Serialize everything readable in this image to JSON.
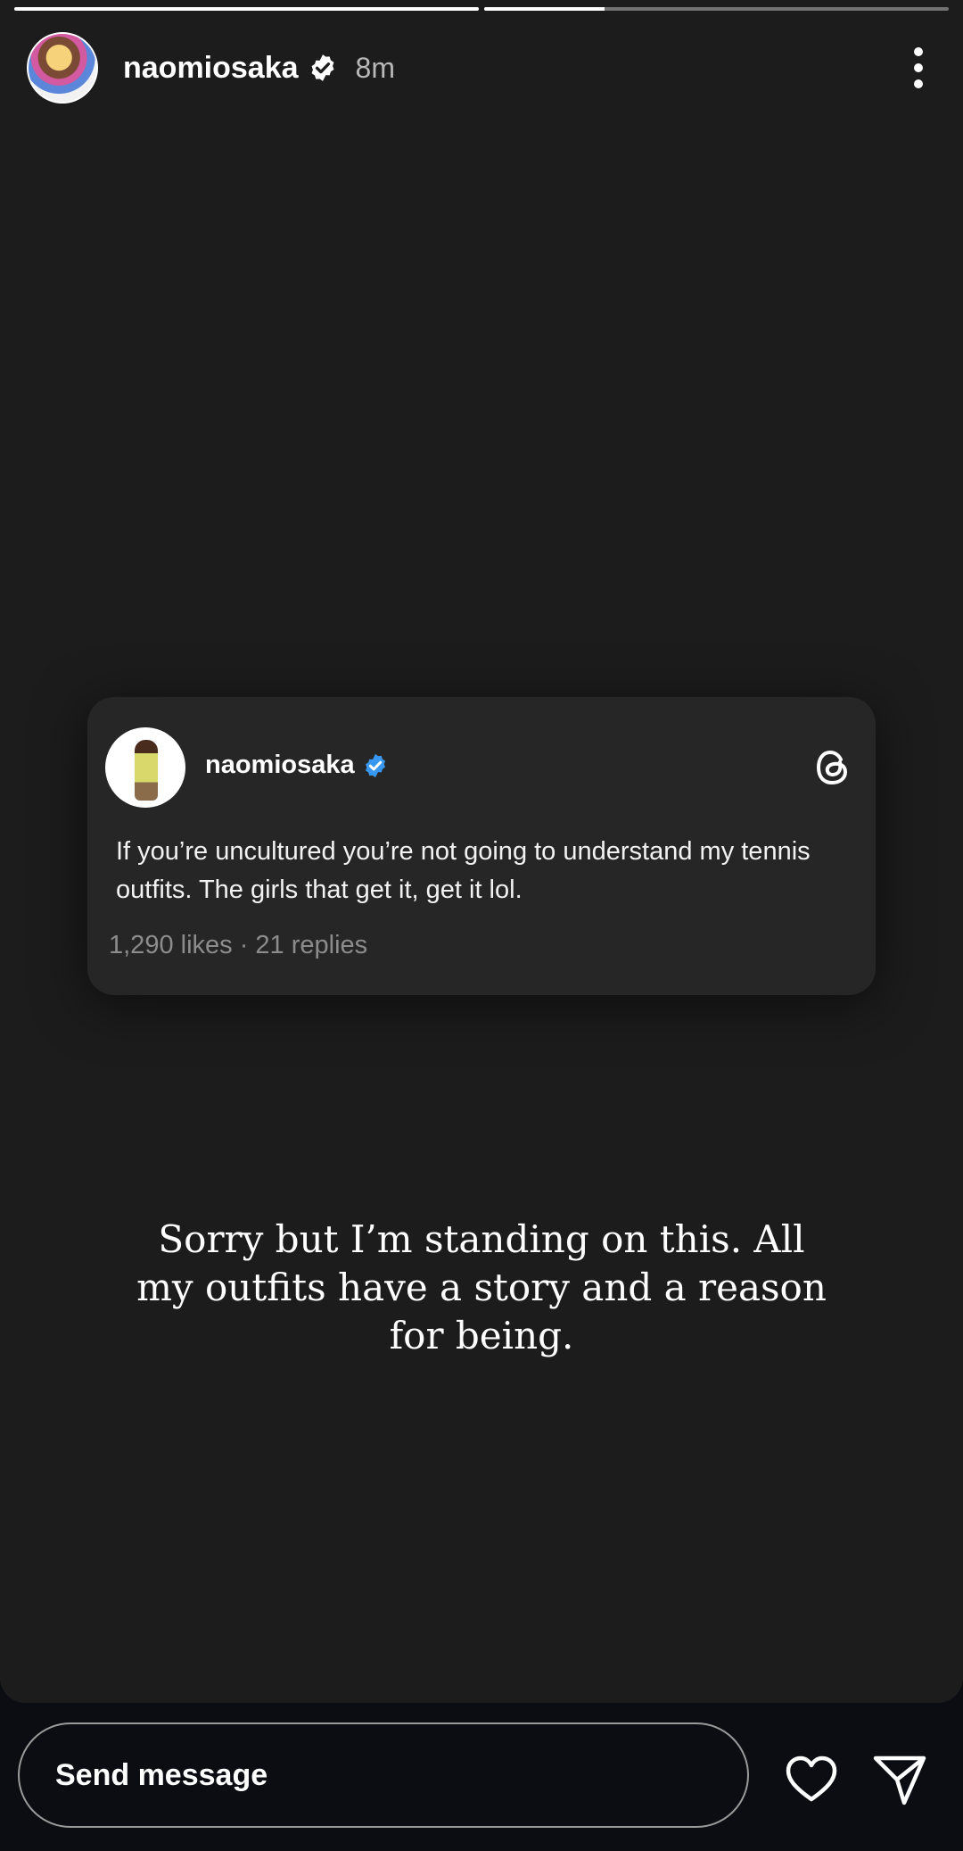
{
  "progress": [
    1.0,
    0.26
  ],
  "header": {
    "username": "naomiosaka",
    "time": "8m"
  },
  "card": {
    "username": "naomiosaka",
    "text": "If you’re uncultured you’re not going to understand my tennis outfits. The girls that get it, get it lol.",
    "meta": "1,290 likes · 21 replies"
  },
  "caption": "Sorry but I’m standing on this. All my outfits have a story and a reason for being.",
  "footer": {
    "message_placeholder": "Send message"
  },
  "icons": {
    "verified_white": "verified-badge-icon",
    "verified_blue": "verified-badge-icon",
    "threads": "threads-logo-icon",
    "more": "more-vertical-icon",
    "like": "heart-icon",
    "send": "send-icon"
  },
  "colors": {
    "background": "#1c1c1c",
    "footer": "#0b0d12",
    "card": "#262626",
    "verified_blue": "#3897f0"
  }
}
